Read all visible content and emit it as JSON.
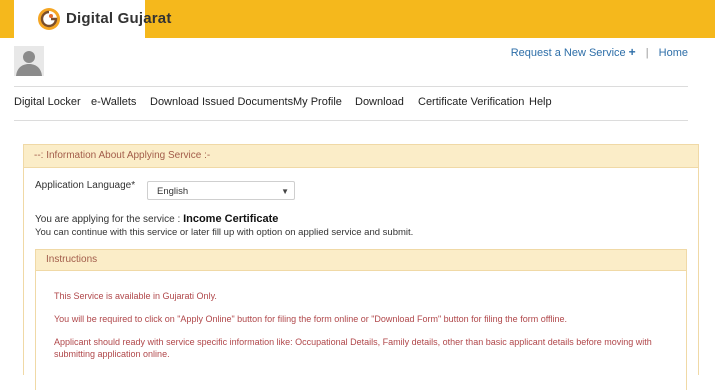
{
  "header": {
    "brand": "Digital Gujarat",
    "logo_icon": "digital-gujarat-logo-icon",
    "colors": {
      "bar": "#f5b81c",
      "link": "#2d6ea8",
      "instruction_text": "#b0474a"
    }
  },
  "user": {
    "avatar_icon": "user-silhouette-icon"
  },
  "top_links": {
    "request_service": "Request a New Service",
    "plus": "+",
    "separator": "|",
    "home": "Home"
  },
  "nav": [
    "Digital Locker",
    "e-Wallets",
    "Download Issued Documents",
    "My Profile",
    "Download",
    "Certificate Verification",
    "Help"
  ],
  "panel": {
    "title": "--: Information About Applying Service :-",
    "language_label": "Application Language*",
    "language_value": "English",
    "service_prefix": "You are applying for the service :",
    "service_name": "Income Certificate",
    "service_note": "You can continue with this service or later fill up with option on applied service and submit."
  },
  "instructions": {
    "title": "Instructions",
    "items": [
      "This Service is available in Gujarati Only.",
      "You will be required to click on \"Apply Online\" button for filing the form online or \"Download Form\" button for filing the form offline.",
      "Applicant should ready with service specific information like: Occupational Details, Family details, other than basic applicant details before moving with submitting application online."
    ]
  }
}
